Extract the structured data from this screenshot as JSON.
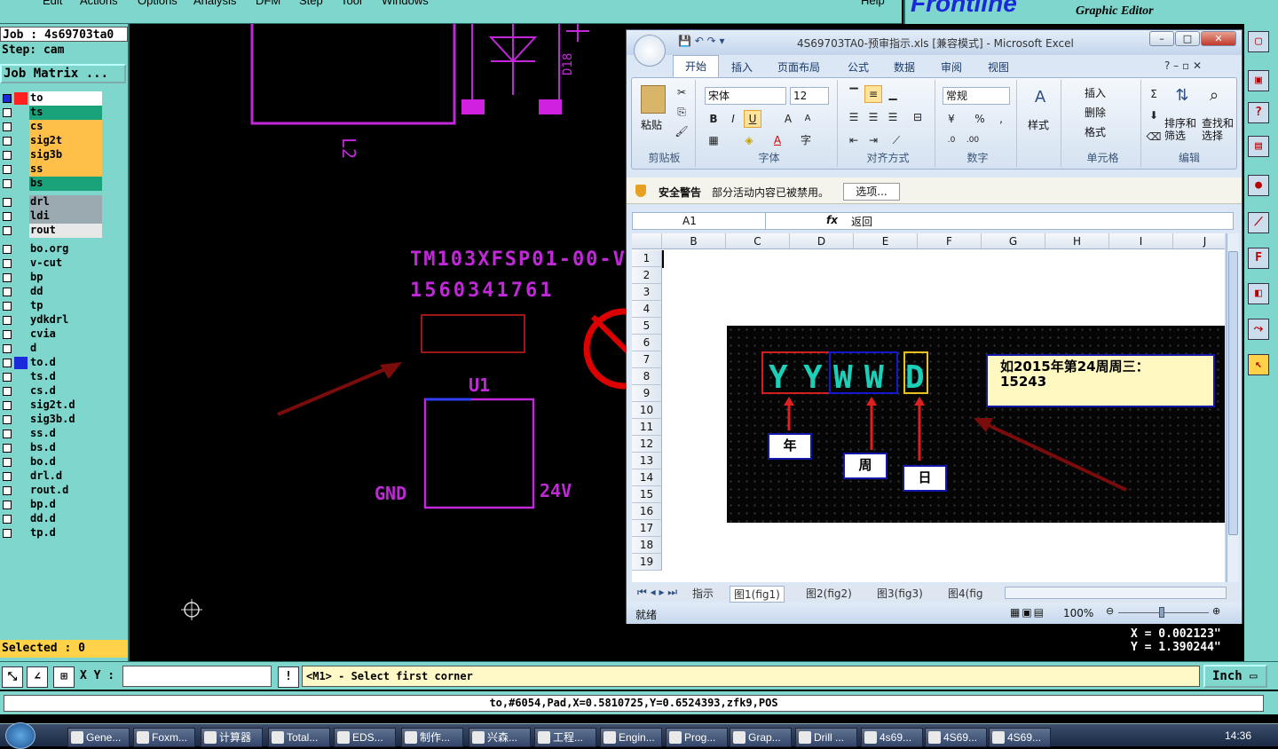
{
  "menubar": {
    "items": [
      "Edit",
      "Actions",
      "Options",
      "Analysis",
      "DFM",
      "Step",
      "Tool",
      "Windows",
      "Help"
    ]
  },
  "brand": {
    "logo": "Frontline",
    "subtitle": "Graphic Editor"
  },
  "job": {
    "job_line": "Job : 4s69703ta0",
    "step_line": "Step: cam",
    "matrix_button": "Job Matrix ..."
  },
  "layers": [
    {
      "name": "to",
      "color": "#ffffff",
      "swatch": "#ff2020",
      "checked": true
    },
    {
      "name": "ts",
      "color": "#1aa37a",
      "swatch": "",
      "checked": false
    },
    {
      "name": "cs",
      "color": "#ffc04a",
      "swatch": "",
      "checked": false
    },
    {
      "name": "sig2t",
      "color": "#ffc04a",
      "swatch": "",
      "checked": false
    },
    {
      "name": "sig3b",
      "color": "#ffc04a",
      "swatch": "",
      "checked": false
    },
    {
      "name": "ss",
      "color": "#ffc04a",
      "swatch": "",
      "checked": false
    },
    {
      "name": "bs",
      "color": "#1aa37a",
      "swatch": "",
      "checked": false
    },
    {
      "name": "drl",
      "color": "#9aaab0",
      "swatch": "",
      "checked": false
    },
    {
      "name": "ldi",
      "color": "#9aaab0",
      "swatch": "",
      "checked": false
    },
    {
      "name": "rout",
      "color": "#e8e8e8",
      "swatch": "",
      "checked": false
    },
    {
      "name": "bo.org",
      "color": "#7fd6cc",
      "swatch": "",
      "checked": false
    },
    {
      "name": "v-cut",
      "color": "#7fd6cc",
      "swatch": "",
      "checked": false
    },
    {
      "name": "bp",
      "color": "#7fd6cc",
      "swatch": "",
      "checked": false
    },
    {
      "name": "dd",
      "color": "#7fd6cc",
      "swatch": "",
      "checked": false
    },
    {
      "name": "tp",
      "color": "#7fd6cc",
      "swatch": "",
      "checked": false
    },
    {
      "name": "ydkdrl",
      "color": "#7fd6cc",
      "swatch": "",
      "checked": false
    },
    {
      "name": "cvia",
      "color": "#7fd6cc",
      "swatch": "",
      "checked": false
    },
    {
      "name": "d",
      "color": "#7fd6cc",
      "swatch": "",
      "checked": false
    },
    {
      "name": "to.d",
      "color": "#7fd6cc",
      "swatch": "#1a2adb",
      "checked": false
    },
    {
      "name": "ts.d",
      "color": "#7fd6cc",
      "swatch": "",
      "checked": false
    },
    {
      "name": "cs.d",
      "color": "#7fd6cc",
      "swatch": "",
      "checked": false
    },
    {
      "name": "sig2t.d",
      "color": "#7fd6cc",
      "swatch": "",
      "checked": false
    },
    {
      "name": "sig3b.d",
      "color": "#7fd6cc",
      "swatch": "",
      "checked": false
    },
    {
      "name": "ss.d",
      "color": "#7fd6cc",
      "swatch": "",
      "checked": false
    },
    {
      "name": "bs.d",
      "color": "#7fd6cc",
      "swatch": "",
      "checked": false
    },
    {
      "name": "bo.d",
      "color": "#7fd6cc",
      "swatch": "",
      "checked": false
    },
    {
      "name": "drl.d",
      "color": "#7fd6cc",
      "swatch": "",
      "checked": false
    },
    {
      "name": "rout.d",
      "color": "#7fd6cc",
      "swatch": "",
      "checked": false
    },
    {
      "name": "bp.d",
      "color": "#7fd6cc",
      "swatch": "",
      "checked": false
    },
    {
      "name": "dd.d",
      "color": "#7fd6cc",
      "swatch": "",
      "checked": false
    },
    {
      "name": "tp.d",
      "color": "#7fd6cc",
      "swatch": "",
      "checked": false
    }
  ],
  "selected_text": "Selected : 0",
  "canvas": {
    "ref_l2": "L2",
    "ref_d18": "D18",
    "part_text": "TM103XFSP01-00-V",
    "serial_text": "1560341761",
    "u1": "U1",
    "gnd": "GND",
    "v24": "24V"
  },
  "coords": {
    "x": "X = 0.002123\"",
    "y": "Y = 1.390244\""
  },
  "cmd": {
    "xy_label": "X Y :",
    "xy_value": "",
    "prompt": "<M1> - Select first corner",
    "unit": "Inch"
  },
  "status_text": "to,#6054,Pad,X=0.5810725,Y=0.6524393,zfk9,POS",
  "excel": {
    "title": "4S69703TA0-预审指示.xls  [兼容模式] - Microsoft Excel",
    "tabs": [
      "开始",
      "插入",
      "页面布局",
      "公式",
      "数据",
      "审阅",
      "视图"
    ],
    "groups": {
      "clipboard": "剪贴板",
      "font": "字体",
      "align": "对齐方式",
      "number": "数字",
      "cells": "单元格",
      "edit": "编辑"
    },
    "paste": "粘贴",
    "font_name": "宋体",
    "font_size": "12",
    "number_format": "常规",
    "style": "样式",
    "insert": "插入",
    "delete": "删除",
    "format": "格式",
    "sort": "排序和\n筛选",
    "sort1": "排序和",
    "sort2": "筛选",
    "find1": "查找和",
    "find2": "选择",
    "security_title": "安全警告",
    "security_msg": "部分活动内容已被禁用。",
    "options_btn": "选项...",
    "name_box": "A1",
    "formula_value": "返回",
    "columns": [
      "B",
      "C",
      "D",
      "E",
      "F",
      "G",
      "H",
      "I",
      "J"
    ],
    "rows": [
      "1",
      "2",
      "3",
      "4",
      "5",
      "6",
      "7",
      "8",
      "9",
      "10",
      "11",
      "12",
      "13",
      "14",
      "15",
      "16",
      "17",
      "18",
      "19"
    ],
    "image": {
      "letters": [
        "Y",
        "Y",
        "W",
        "W",
        "D"
      ],
      "label_year": "年",
      "label_week": "周",
      "label_day": "日",
      "note": "如2015年第24周周三：\n15243",
      "note1": "如2015年第24周周三：",
      "note2": "15243"
    },
    "sheets": [
      "指示",
      "图1(fig1)",
      "图2(fig2)",
      "图3(fig3)",
      "图4(fig"
    ],
    "status_ready": "就绪",
    "zoom": "100%"
  },
  "taskbar": {
    "items": [
      "Gene...",
      "Foxm...",
      "计算器",
      "Total...",
      "EDS...",
      "制作...",
      "兴森...",
      "工程...",
      "Engin...",
      "Prog...",
      "Grap...",
      "Drill ...",
      "4s69...",
      "4S69...",
      "4S69..."
    ],
    "clock": "14:36"
  }
}
